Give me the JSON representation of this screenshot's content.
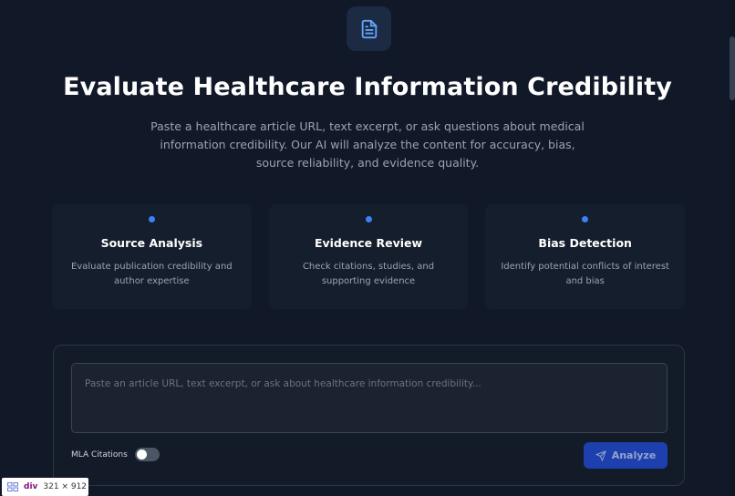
{
  "hero": {
    "icon": "document-icon",
    "title": "Evaluate Healthcare Information Credibility",
    "subtitle": "Paste a healthcare article URL, text excerpt, or ask questions about medical information credibility. Our AI will analyze the content for accuracy, bias, source reliability, and evidence quality."
  },
  "features": [
    {
      "title": "Source Analysis",
      "description": "Evaluate publication credibility and author expertise"
    },
    {
      "title": "Evidence Review",
      "description": "Check citations, studies, and supporting evidence"
    },
    {
      "title": "Bias Detection",
      "description": "Identify potential conflicts of interest and bias"
    }
  ],
  "input": {
    "placeholder": "Paste an article URL, text excerpt, or ask about healthcare information credibility...",
    "value": ""
  },
  "options": {
    "mla_label": "MLA Citations",
    "mla_enabled": false
  },
  "actions": {
    "analyze_label": "Analyze"
  },
  "devtools": {
    "tag": "div",
    "dimensions": "321 × 912"
  },
  "colors": {
    "background": "#111827",
    "accent": "#3b82f6",
    "button": "#1e40af"
  }
}
